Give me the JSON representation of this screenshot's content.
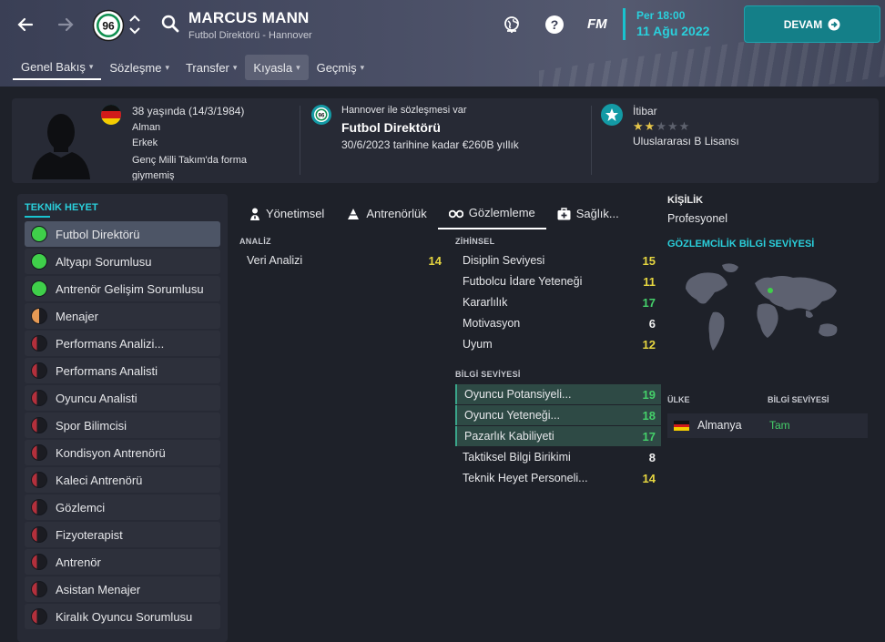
{
  "header": {
    "person_name": "MARCUS MANN",
    "person_role": "Futbol Direktörü - Hannover",
    "club_badge_text": "96",
    "fm_logo": "FM",
    "date_day": "Per 18:00",
    "date_date": "11 Ağu 2022",
    "continue_label": "DEVAM"
  },
  "tabs": [
    {
      "label": "Genel Bakış"
    },
    {
      "label": "Sözleşme"
    },
    {
      "label": "Transfer"
    },
    {
      "label": "Kıyasla"
    },
    {
      "label": "Geçmiş"
    }
  ],
  "profile": {
    "age": "38 yaşında (14/3/1984)",
    "nationality": "Alman",
    "gender": "Erkek",
    "youth_caps": "Genç Milli Takım'da forma giymemiş",
    "contract_club": "Hannover ile sözleşmesi var",
    "contract_role": "Futbol Direktörü",
    "contract_terms": "30/6/2023 tarihine kadar €260B yıllık",
    "reputation_label": "İtibar",
    "reputation_stars": 2,
    "reputation_max": 5,
    "license": "Uluslararası B Lisansı"
  },
  "staff_panel": {
    "title": "TEKNİK HEYET",
    "items": [
      {
        "label": "Futbol Direktörü",
        "level": "full"
      },
      {
        "label": "Altyapı Sorumlusu",
        "level": "full"
      },
      {
        "label": "Antrenör Gelişim Sorumlusu",
        "level": "full"
      },
      {
        "label": "Menajer",
        "level": "half"
      },
      {
        "label": "Performans Analizi...",
        "level": "none"
      },
      {
        "label": "Performans Analisti",
        "level": "none"
      },
      {
        "label": "Oyuncu Analisti",
        "level": "none"
      },
      {
        "label": "Spor Bilimcisi",
        "level": "none"
      },
      {
        "label": "Kondisyon Antrenörü",
        "level": "none"
      },
      {
        "label": "Kaleci Antrenörü",
        "level": "none"
      },
      {
        "label": "Gözlemci",
        "level": "none"
      },
      {
        "label": "Fizyoterapist",
        "level": "none"
      },
      {
        "label": "Antrenör",
        "level": "none"
      },
      {
        "label": "Asistan Menajer",
        "level": "none"
      },
      {
        "label": "Kiralık Oyuncu Sorumlusu",
        "level": "none"
      }
    ]
  },
  "center_tabs": [
    {
      "label": "Yönetimsel"
    },
    {
      "label": "Antrenörlük"
    },
    {
      "label": "Gözlemleme"
    },
    {
      "label": "Sağlık..."
    }
  ],
  "analysis": {
    "title": "ANALİZ",
    "rows": [
      {
        "label": "Veri Analizi",
        "value": "14",
        "color": "yellow"
      }
    ]
  },
  "mental": {
    "title": "ZİHİNSEL",
    "rows": [
      {
        "label": "Disiplin Seviyesi",
        "value": "15",
        "color": "yellow"
      },
      {
        "label": "Futbolcu İdare Yeteneği",
        "value": "11",
        "color": "yellow"
      },
      {
        "label": "Kararlılık",
        "value": "17",
        "color": "green"
      },
      {
        "label": "Motivasyon",
        "value": "6",
        "color": "white"
      },
      {
        "label": "Uyum",
        "value": "12",
        "color": "yellow"
      }
    ]
  },
  "knowledge": {
    "title": "BİLGİ SEVİYESİ",
    "rows": [
      {
        "label": "Oyuncu Potansiyeli...",
        "value": "19",
        "color": "green",
        "hl": true
      },
      {
        "label": "Oyuncu Yeteneği...",
        "value": "18",
        "color": "green",
        "hl": true
      },
      {
        "label": "Pazarlık Kabiliyeti",
        "value": "17",
        "color": "green",
        "hl": true
      },
      {
        "label": "Taktiksel Bilgi Birikimi",
        "value": "8",
        "color": "white",
        "hl": false
      },
      {
        "label": "Teknik Heyet Personeli...",
        "value": "14",
        "color": "yellow",
        "hl": false
      }
    ]
  },
  "right": {
    "personality_title": "KİŞİLİK",
    "personality_value": "Profesyonel",
    "scouting_title": "GÖZLEMCİLİK BİLGİ SEVİYESİ",
    "col_country": "ÜLKE",
    "col_level": "BİLGİ SEVİYESİ",
    "country": "Almanya",
    "country_level": "Tam"
  },
  "colors": {
    "accent": "#19c3cf",
    "continue_btn": "#147f88",
    "value_yellow": "#e6d640",
    "value_green": "#45d06a",
    "staff_full": "#3fcf4a",
    "staff_half": "#e69a55",
    "staff_none": "#b3303c"
  },
  "icons": {
    "back": "arrow-left-icon",
    "forward": "arrow-right-icon",
    "search": "search-icon",
    "globe": "globe-icon",
    "help": "question-icon",
    "continue": "arrow-circle-icon"
  }
}
